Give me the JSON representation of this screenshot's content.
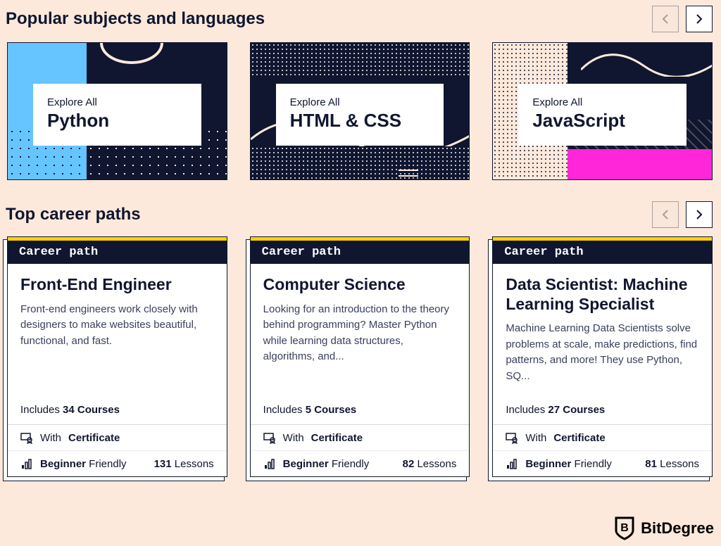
{
  "sections": {
    "subjects": {
      "title": "Popular subjects and languages",
      "cards": [
        {
          "explore": "Explore All",
          "name": "Python"
        },
        {
          "explore": "Explore All",
          "name": "HTML & CSS"
        },
        {
          "explore": "Explore All",
          "name": "JavaScript"
        }
      ]
    },
    "careers": {
      "title": "Top career paths",
      "badge_label": "Career path",
      "cards": [
        {
          "title": "Front-End Engineer",
          "desc": "Front-end engineers work closely with designers to make websites beautiful, functional, and fast.",
          "includes_prefix": "Includes ",
          "courses_count": "34 Courses",
          "cert_prefix": "With ",
          "cert_word": "Certificate",
          "level_bold": "Beginner",
          "level_rest": " Friendly",
          "lessons_count": "131",
          "lessons_word": " Lessons"
        },
        {
          "title": "Computer Science",
          "desc": "Looking for an introduction to the theory behind programming? Master Python while learning data structures, algorithms, and...",
          "includes_prefix": "Includes ",
          "courses_count": "5 Courses",
          "cert_prefix": "With ",
          "cert_word": "Certificate",
          "level_bold": "Beginner",
          "level_rest": " Friendly",
          "lessons_count": "82",
          "lessons_word": " Lessons"
        },
        {
          "title": "Data Scientist: Machine Learning Specialist",
          "desc": "Machine Learning Data Scientists solve problems at scale, make predictions, find patterns, and more! They use Python, SQ...",
          "includes_prefix": "Includes ",
          "courses_count": "27 Courses",
          "cert_prefix": "With ",
          "cert_word": "Certificate",
          "level_bold": "Beginner",
          "level_rest": " Friendly",
          "lessons_count": "81",
          "lessons_word": " Lessons"
        }
      ]
    }
  },
  "brand": {
    "name": "BitDegree"
  }
}
